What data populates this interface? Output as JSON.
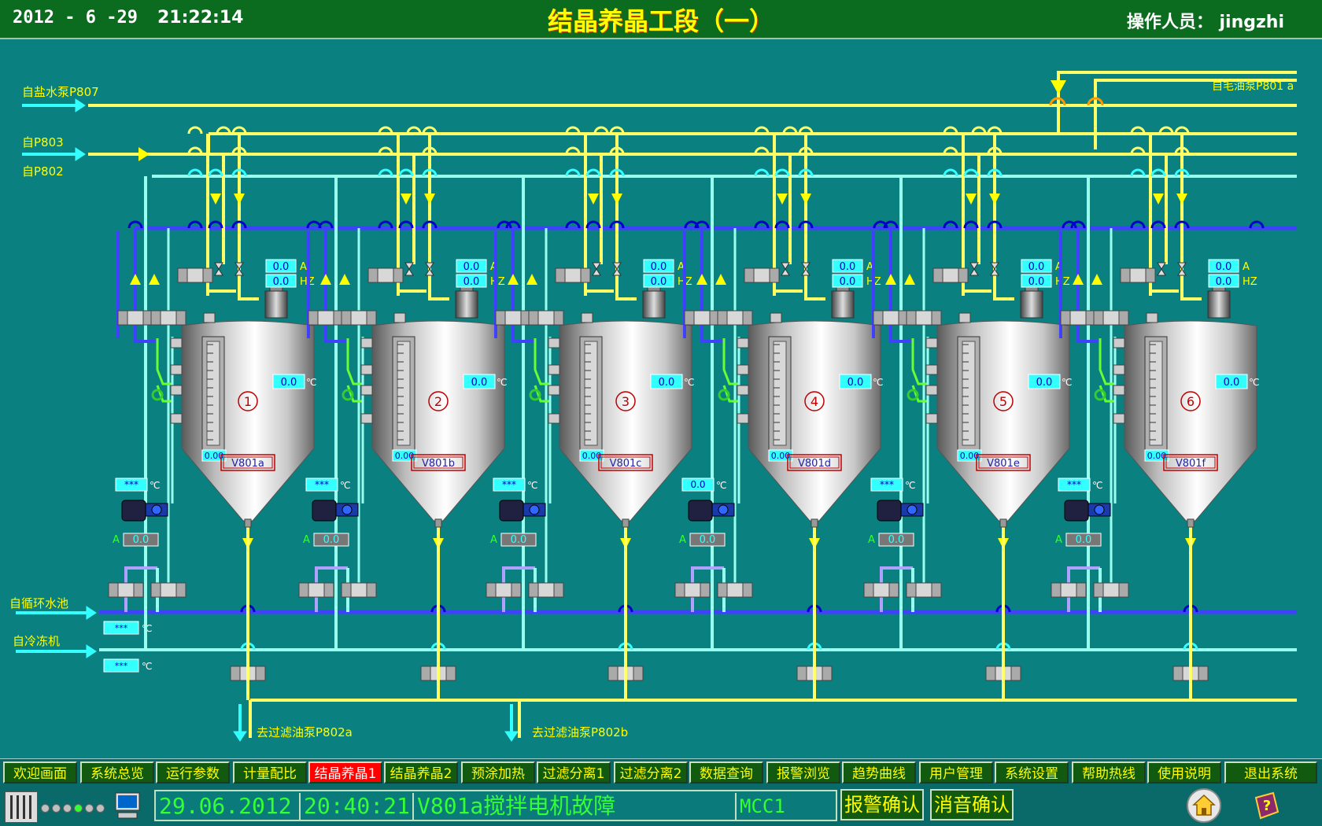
{
  "header": {
    "date": "2012 - 6 -29",
    "time": "21:22:14",
    "title": "结晶养晶工段（一）",
    "operator": "操作人员： jingzhi"
  },
  "sources": {
    "brine_pump": "自盐水泵P807",
    "p803": "自P803",
    "p802": "自P802",
    "crude_oil_pump": "自毛油泵P801 a",
    "circ_pool": "自循环水池",
    "chiller": "自冷冻机",
    "filter_a": "去过滤油泵P802a",
    "filter_b": "去过滤油泵P802b"
  },
  "units": {
    "amp": "A",
    "hz": "HZ",
    "celsius": "℃"
  },
  "tanks": [
    {
      "number": "1",
      "tag": "V801a",
      "motor_a": "0.0",
      "motor_hz": "0.0",
      "temp": "0.0",
      "level": "0.00",
      "jacket_temp": "***",
      "valve_a": "0.0"
    },
    {
      "number": "2",
      "tag": "V801b",
      "motor_a": "0.0",
      "motor_hz": "0.0",
      "temp": "0.0",
      "level": "0.00",
      "jacket_temp": "***",
      "valve_a": "0.0"
    },
    {
      "number": "3",
      "tag": "V801c",
      "motor_a": "0.0",
      "motor_hz": "0.0",
      "temp": "0.0",
      "level": "0.00",
      "jacket_temp": "***",
      "valve_a": "0.0"
    },
    {
      "number": "4",
      "tag": "V801d",
      "motor_a": "0.0",
      "motor_hz": "0.0",
      "temp": "0.0",
      "level": "0.00",
      "jacket_temp": "0.0",
      "valve_a": "0.0"
    },
    {
      "number": "5",
      "tag": "V801e",
      "motor_a": "0.0",
      "motor_hz": "0.0",
      "temp": "0.0",
      "level": "0.00",
      "jacket_temp": "***",
      "valve_a": "0.0"
    },
    {
      "number": "6",
      "tag": "V801f",
      "motor_a": "0.0",
      "motor_hz": "0.0",
      "temp": "0.0",
      "level": "0.00",
      "jacket_temp": "***",
      "valve_a": "0.0"
    }
  ],
  "header_temps": {
    "circ": "***",
    "chill": "***"
  },
  "nav": [
    {
      "label": "欢迎画面",
      "active": false
    },
    {
      "label": "系统总览",
      "active": false
    },
    {
      "label": "运行参数",
      "active": false
    },
    {
      "label": "计量配比",
      "active": false
    },
    {
      "label": "结晶养晶1",
      "active": true
    },
    {
      "label": "结晶养晶2",
      "active": false
    },
    {
      "label": "预涂加热",
      "active": false
    },
    {
      "label": "过滤分离1",
      "active": false
    },
    {
      "label": "过滤分离2",
      "active": false
    },
    {
      "label": "数据查询",
      "active": false
    },
    {
      "label": "报警浏览",
      "active": false
    },
    {
      "label": "趋势曲线",
      "active": false
    },
    {
      "label": "用户管理",
      "active": false
    },
    {
      "label": "系统设置",
      "active": false
    },
    {
      "label": "帮助热线",
      "active": false
    },
    {
      "label": "使用说明",
      "active": false
    },
    {
      "label": "退出系统",
      "active": false
    }
  ],
  "status": {
    "alarm_date": "29.06.2012",
    "alarm_time": "20:40:21",
    "alarm_msg": "V801a搅拌电机故障",
    "alarm_src": "MCC1",
    "ack_label": "报警确认",
    "mute_label": "消音确认"
  },
  "colors": {
    "background": "#0a8080",
    "header": "#0b6b1e",
    "yellow_line": "#ffff66",
    "cyan_line": "#99ffee",
    "blue_line": "#4040ff",
    "active_nav": "#ff0000",
    "alarm_text": "#33ff33"
  }
}
